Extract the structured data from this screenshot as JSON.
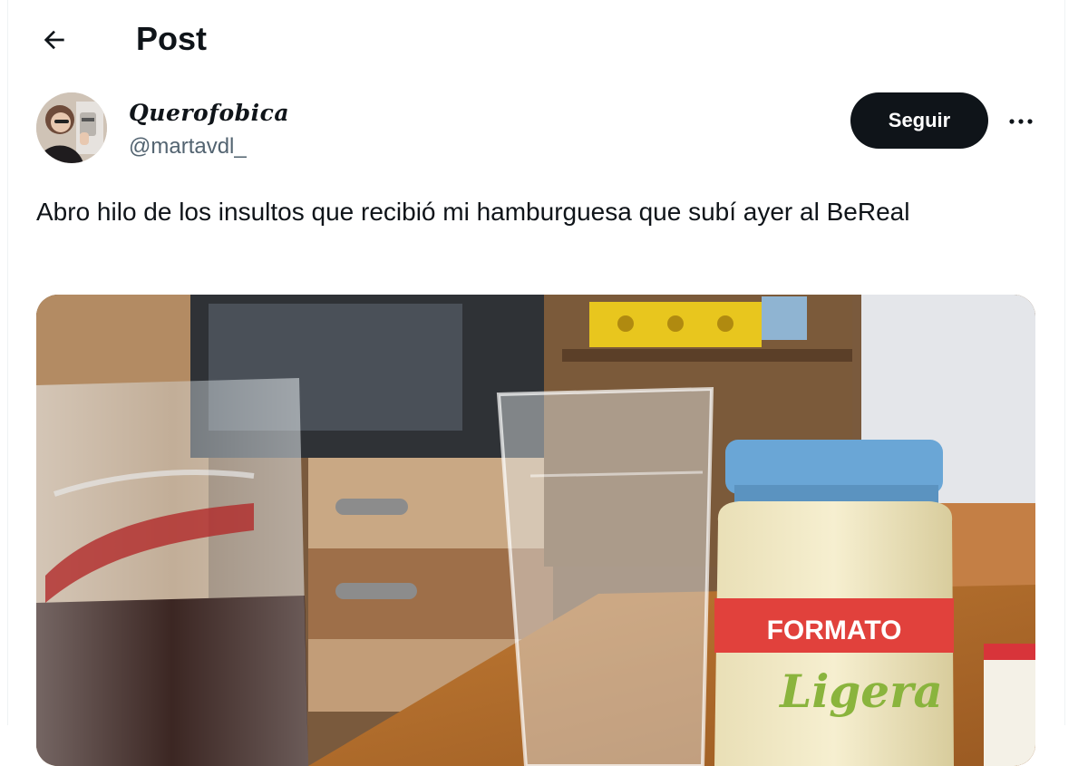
{
  "header": {
    "title": "Post"
  },
  "author": {
    "display_name": "Querofobica",
    "handle": "@martavdl_"
  },
  "actions": {
    "follow_label": "Seguir"
  },
  "tweet": {
    "text": "Abro hilo de los insultos que recibió mi hamburguesa que subí ayer al BeReal"
  },
  "media": {
    "jar_label": "FORMATO",
    "jar_brand": "Ligera"
  },
  "colors": {
    "text": "#0f1419",
    "secondary": "#536471",
    "follow_bg": "#0f1419",
    "divider": "#eff3f4"
  },
  "icons": {
    "back": "arrow-left-icon",
    "more": "more-horizontal-icon"
  }
}
